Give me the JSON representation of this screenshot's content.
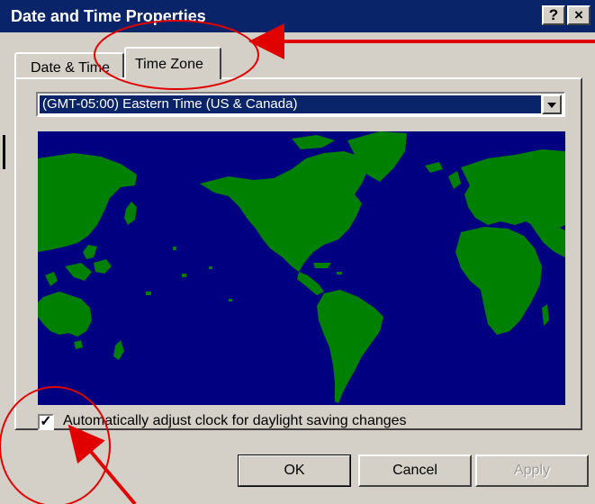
{
  "window": {
    "title": "Date and Time Properties",
    "help_button": "?",
    "close_button": "×"
  },
  "tabs": [
    {
      "label": "Date & Time",
      "selected": false
    },
    {
      "label": "Time Zone",
      "selected": true
    }
  ],
  "timezone": {
    "selected_value": "(GMT-05:00) Eastern Time (US & Canada)"
  },
  "daylight": {
    "label": "Automatically adjust clock for daylight saving changes",
    "checked": true,
    "check_glyph": "✓"
  },
  "buttons": {
    "ok": "OK",
    "cancel": "Cancel",
    "apply": "Apply"
  },
  "colors": {
    "titlebar": "#0a246a",
    "ocean": "#000080",
    "land": "#008000",
    "annotation": "#e00000"
  },
  "icons": [
    "help-icon",
    "close-icon",
    "dropdown-arrow-icon",
    "checkmark-icon"
  ]
}
